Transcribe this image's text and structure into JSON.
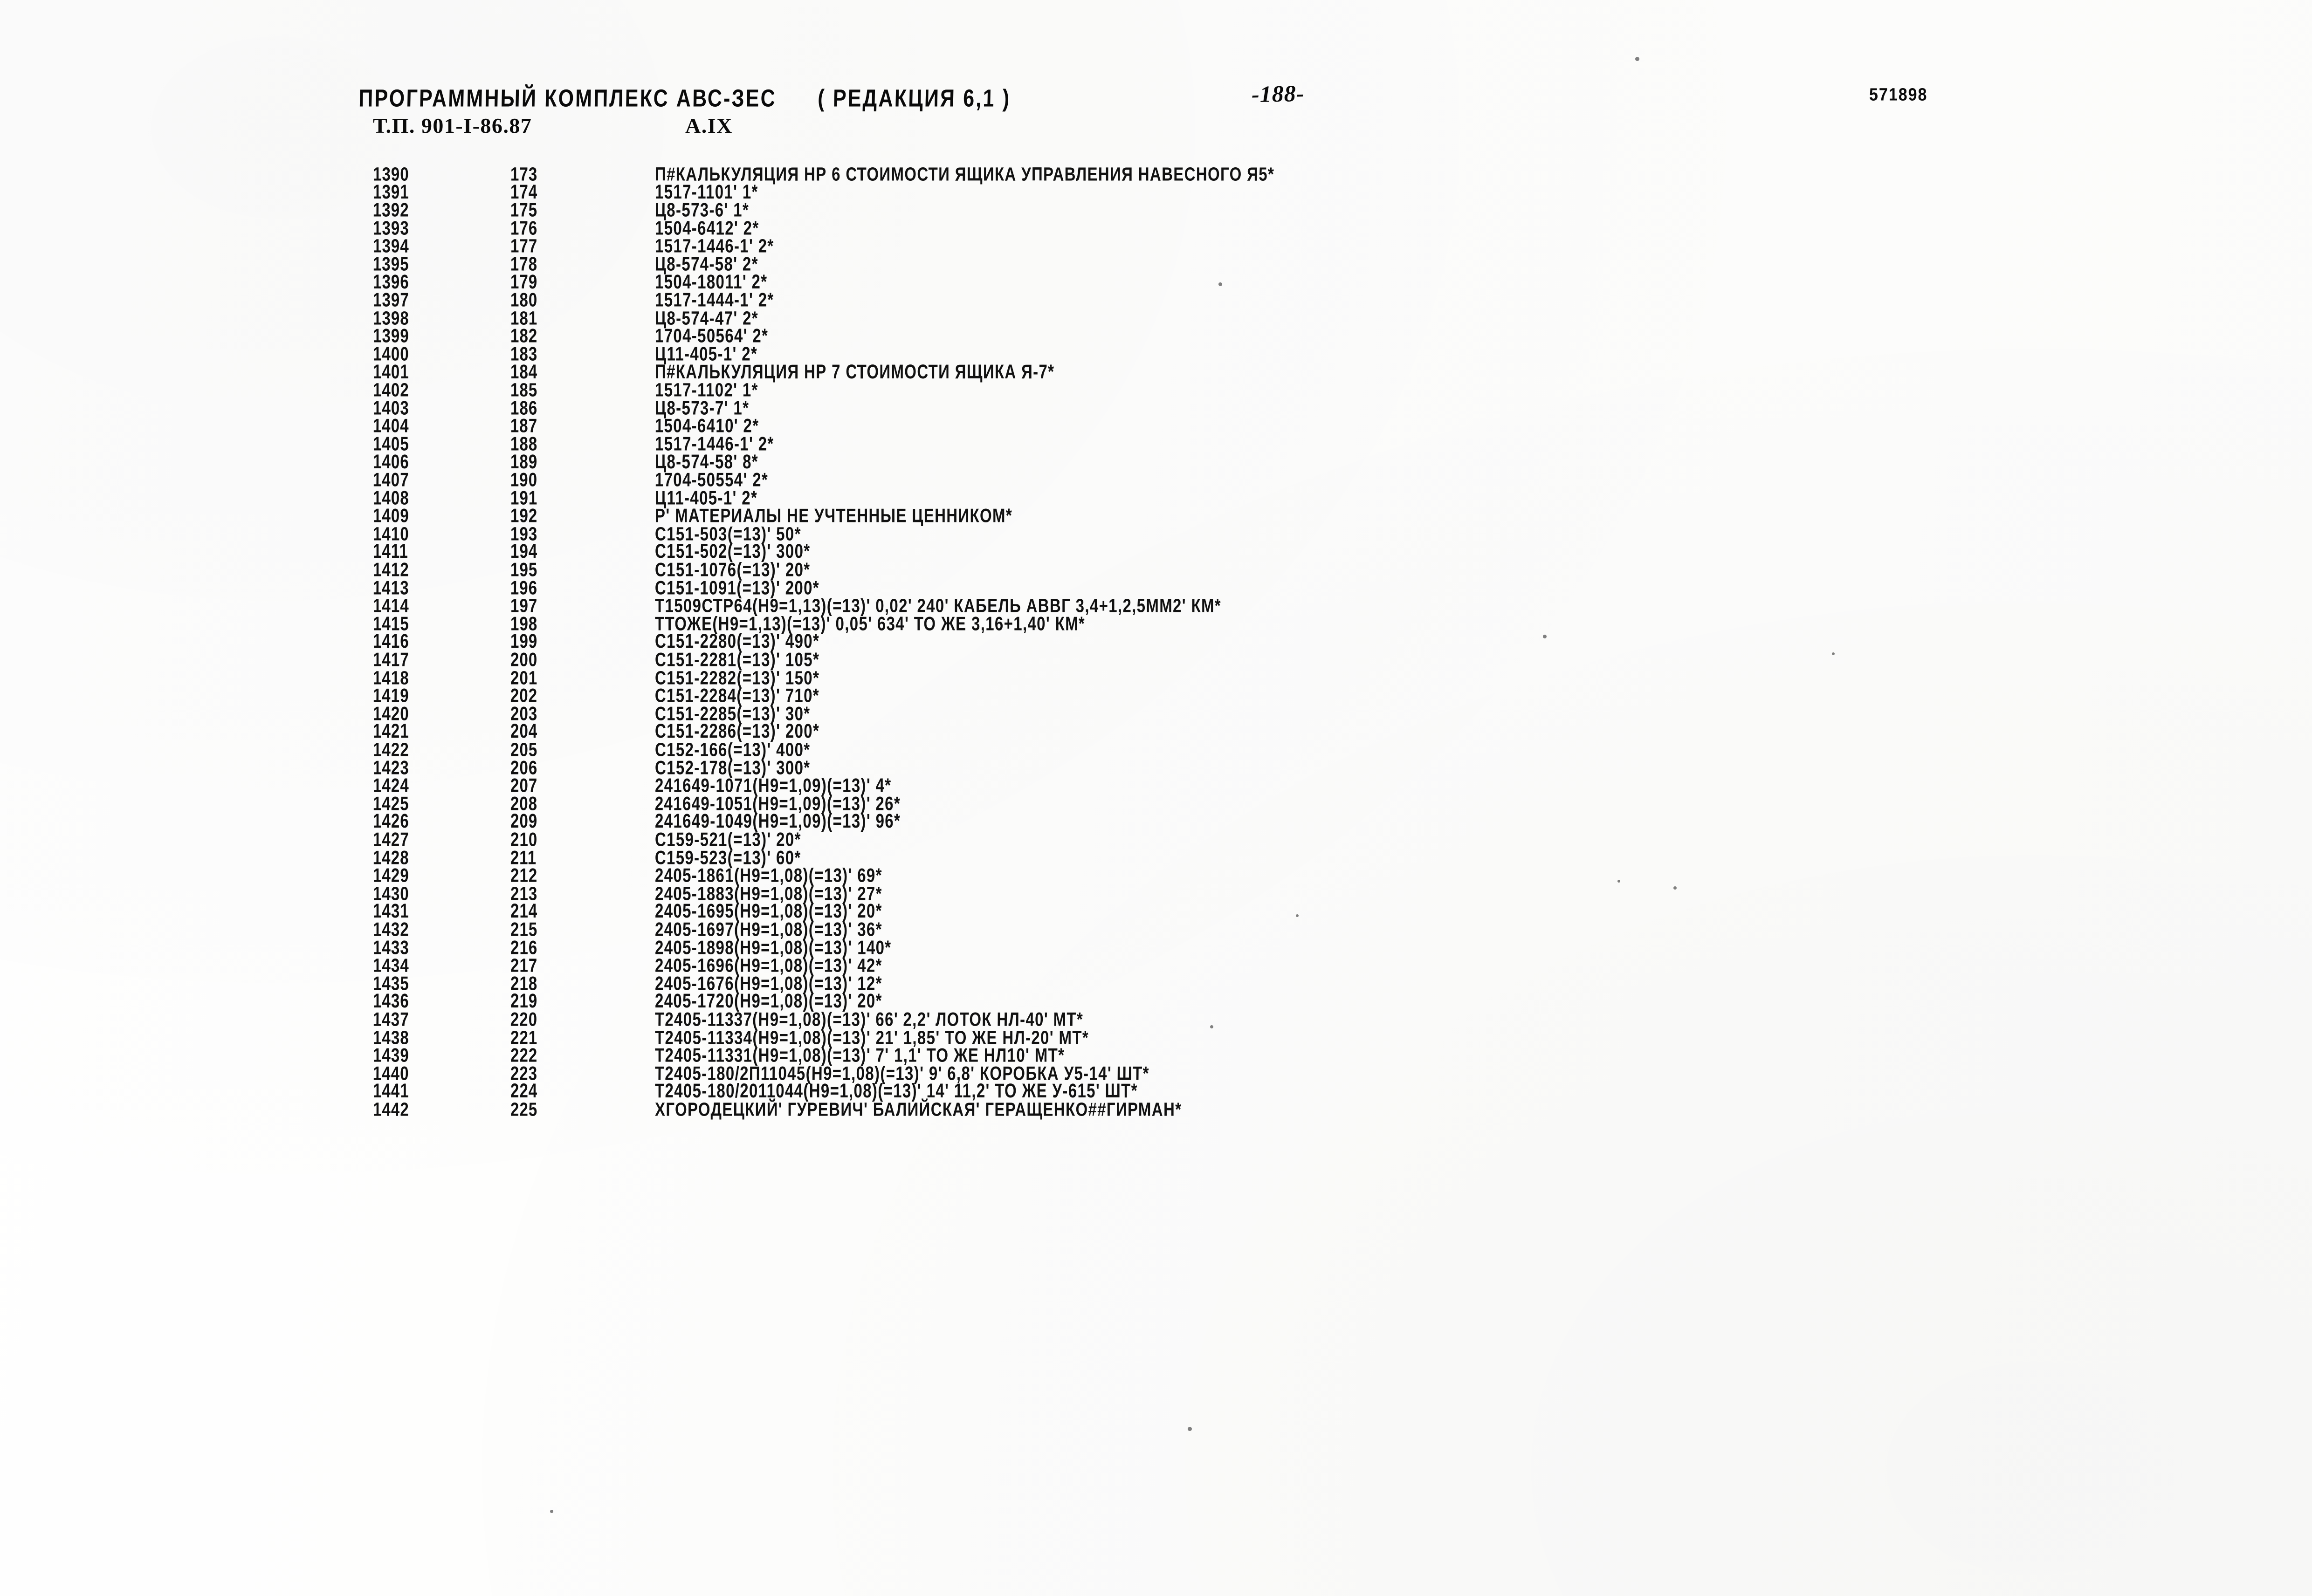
{
  "header": {
    "system_title": "ПРОГРАММНЫЙ КОМПЛЕКС АВС-ЗЕС",
    "edition": "( РЕДАКЦИЯ  6,1 )",
    "page_number": "-188-",
    "doc_number": "571898",
    "type_project": "Т.П. 901-I-86.87",
    "section": "А.IX"
  },
  "columns": {
    "seq_header": "",
    "num_header": "",
    "text_header": ""
  },
  "rows": [
    {
      "seq": "1390",
      "num": "173",
      "text": "П#КАЛЬКУЛЯЦИЯ НР 6 СТОИМОСТИ ЯЩИКА УПРАВЛЕНИЯ НАВЕСНОГО Я5*"
    },
    {
      "seq": "1391",
      "num": "174",
      "text": "1517-1101' 1*"
    },
    {
      "seq": "1392",
      "num": "175",
      "text": "Ц8-573-6' 1*"
    },
    {
      "seq": "1393",
      "num": "176",
      "text": "1504-6412' 2*"
    },
    {
      "seq": "1394",
      "num": "177",
      "text": "1517-1446-1' 2*"
    },
    {
      "seq": "1395",
      "num": "178",
      "text": "Ц8-574-58' 2*"
    },
    {
      "seq": "1396",
      "num": "179",
      "text": "1504-18011' 2*"
    },
    {
      "seq": "1397",
      "num": "180",
      "text": "1517-1444-1' 2*"
    },
    {
      "seq": "1398",
      "num": "181",
      "text": "Ц8-574-47' 2*"
    },
    {
      "seq": "1399",
      "num": "182",
      "text": "1704-50564' 2*"
    },
    {
      "seq": "1400",
      "num": "183",
      "text": "Ц11-405-1' 2*"
    },
    {
      "seq": "1401",
      "num": "184",
      "text": "П#КАЛЬКУЛЯЦИЯ НР 7 СТОИМОСТИ ЯЩИКА Я-7*"
    },
    {
      "seq": "1402",
      "num": "185",
      "text": "1517-1102' 1*"
    },
    {
      "seq": "1403",
      "num": "186",
      "text": "Ц8-573-7' 1*"
    },
    {
      "seq": "1404",
      "num": "187",
      "text": "1504-6410' 2*"
    },
    {
      "seq": "1405",
      "num": "188",
      "text": "1517-1446-1' 2*"
    },
    {
      "seq": "1406",
      "num": "189",
      "text": "Ц8-574-58' 8*"
    },
    {
      "seq": "1407",
      "num": "190",
      "text": "1704-50554' 2*"
    },
    {
      "seq": "1408",
      "num": "191",
      "text": "Ц11-405-1' 2*"
    },
    {
      "seq": "1409",
      "num": "192",
      "text": "Р' МАТЕРИАЛЫ НЕ УЧТЕННЫЕ ЦЕННИКОМ*"
    },
    {
      "seq": "1410",
      "num": "193",
      "text": "С151-503(=13)' 50*"
    },
    {
      "seq": "1411",
      "num": "194",
      "text": "С151-502(=13)' 300*"
    },
    {
      "seq": "1412",
      "num": "195",
      "text": "С151-1076(=13)' 20*"
    },
    {
      "seq": "1413",
      "num": "196",
      "text": "С151-1091(=13)' 200*"
    },
    {
      "seq": "1414",
      "num": "197",
      "text": "Т1509СТР64(Н9=1,13)(=13)' 0,02' 240' КАБЕЛЬ АВВГ 3,4+1,2,5ММ2' КМ*"
    },
    {
      "seq": "1415",
      "num": "198",
      "text": "ТТОЖЕ(Н9=1,13)(=13)' 0,05' 634' ТО ЖЕ 3,16+1,40' КМ*"
    },
    {
      "seq": "1416",
      "num": "199",
      "text": "С151-2280(=13)' 490*"
    },
    {
      "seq": "1417",
      "num": "200",
      "text": "С151-2281(=13)' 105*"
    },
    {
      "seq": "1418",
      "num": "201",
      "text": "С151-2282(=13)' 150*"
    },
    {
      "seq": "1419",
      "num": "202",
      "text": "С151-2284(=13)' 710*"
    },
    {
      "seq": "1420",
      "num": "203",
      "text": "С151-2285(=13)' 30*"
    },
    {
      "seq": "1421",
      "num": "204",
      "text": "С151-2286(=13)' 200*"
    },
    {
      "seq": "1422",
      "num": "205",
      "text": "С152-166(=13)' 400*"
    },
    {
      "seq": "1423",
      "num": "206",
      "text": "С152-178(=13)' 300*"
    },
    {
      "seq": "1424",
      "num": "207",
      "text": "241649-1071(Н9=1,09)(=13)' 4*"
    },
    {
      "seq": "1425",
      "num": "208",
      "text": "241649-1051(Н9=1,09)(=13)' 26*"
    },
    {
      "seq": "1426",
      "num": "209",
      "text": "241649-1049(Н9=1,09)(=13)' 96*"
    },
    {
      "seq": "1427",
      "num": "210",
      "text": "С159-521(=13)' 20*"
    },
    {
      "seq": "1428",
      "num": "211",
      "text": "С159-523(=13)' 60*"
    },
    {
      "seq": "1429",
      "num": "212",
      "text": "2405-1861(Н9=1,08)(=13)' 69*"
    },
    {
      "seq": "1430",
      "num": "213",
      "text": "2405-1883(Н9=1,08)(=13)' 27*"
    },
    {
      "seq": "1431",
      "num": "214",
      "text": "2405-1695(Н9=1,08)(=13)' 20*"
    },
    {
      "seq": "1432",
      "num": "215",
      "text": "2405-1697(Н9=1,08)(=13)' 36*"
    },
    {
      "seq": "1433",
      "num": "216",
      "text": "2405-1898(Н9=1,08)(=13)' 140*"
    },
    {
      "seq": "1434",
      "num": "217",
      "text": "2405-1696(Н9=1,08)(=13)' 42*"
    },
    {
      "seq": "1435",
      "num": "218",
      "text": "2405-1676(Н9=1,08)(=13)' 12*"
    },
    {
      "seq": "1436",
      "num": "219",
      "text": "2405-1720(Н9=1,08)(=13)' 20*"
    },
    {
      "seq": "1437",
      "num": "220",
      "text": "Т2405-11337(Н9=1,08)(=13)' 66' 2,2' ЛОТОК НЛ-40' МТ*"
    },
    {
      "seq": "1438",
      "num": "221",
      "text": "Т2405-11334(Н9=1,08)(=13)' 21' 1,85' ТО ЖЕ НЛ-20' МТ*"
    },
    {
      "seq": "1439",
      "num": "222",
      "text": "Т2405-11331(Н9=1,08)(=13)' 7' 1,1' ТО ЖЕ НЛ10' МТ*"
    },
    {
      "seq": "1440",
      "num": "223",
      "text": "Т2405-180/2П11045(Н9=1,08)(=13)' 9' 6,8' КОРОБКА У5-14' ШТ*"
    },
    {
      "seq": "1441",
      "num": "224",
      "text": "Т2405-180/2011044(Н9=1,08)(=13)' 14' 11,2' ТО ЖЕ У-615' ШТ*"
    },
    {
      "seq": "1442",
      "num": "225",
      "text": "ХГОРОДЕЦКИЙ' ГУРЕВИЧ' БАЛИЙСКАЯ' ГЕРАЩЕНКО##ГИРМАН*"
    }
  ]
}
